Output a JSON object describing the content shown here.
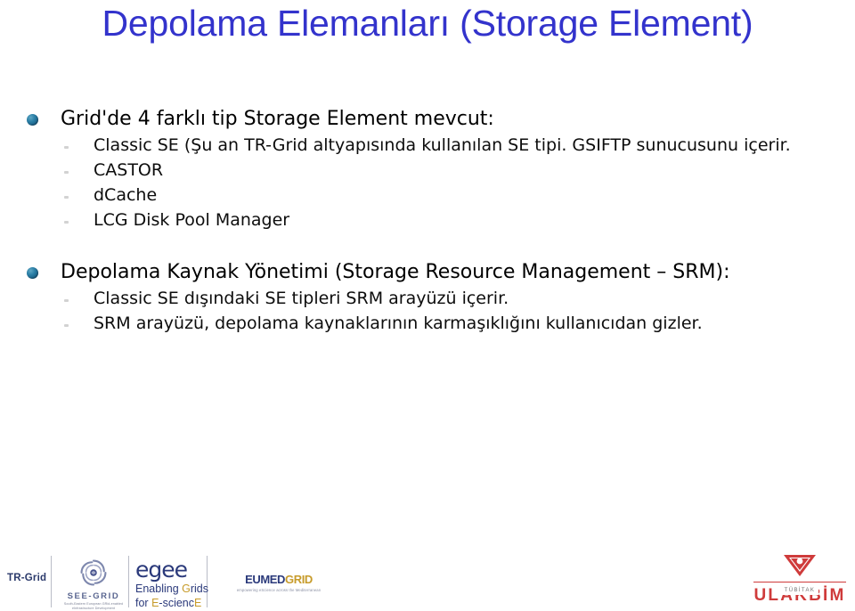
{
  "slide": {
    "title": "Depolama Elemanları (Storage Element)",
    "title_color": "#3333cc",
    "bullet_color": "#1f6b91"
  },
  "content": {
    "groups": [
      {
        "heading": "Grid'de 4 farklı tip Storage Element mevcut:",
        "items": [
          "Classic SE (Şu an TR-Grid altyapısında kullanılan SE tipi. GSIFTP sunucusunu içerir.",
          "CASTOR",
          "dCache",
          "LCG Disk Pool Manager"
        ]
      },
      {
        "heading": "Depolama Kaynak Yönetimi (Storage Resource Management – SRM):",
        "items": [
          "Classic SE dışındaki SE tipleri SRM arayüzü içerir.",
          "SRM arayüzü, depolama kaynaklarının karmaşıklığını kullanıcıdan gizler."
        ]
      }
    ]
  },
  "footer": {
    "trgrid_label": "TR-Grid",
    "seegrid": {
      "name": "SEE-GRID",
      "tagline_line1": "South-Eastern European GRid-enabled",
      "tagline_line2": "eInfrastructure Development"
    },
    "egee": {
      "wordmark": "egee",
      "sub_line1_a": "Enabling ",
      "sub_line1_b": "G",
      "sub_line1_c": "rids",
      "sub_line2_a": "for ",
      "sub_line2_b": "E",
      "sub_line2_c": "-scienc",
      "sub_line2_d": "E"
    },
    "eumedgrid": {
      "word_a": "EUMED",
      "word_b": "GRID",
      "tagline": "empowering eScience across the Mediterranean"
    },
    "ulakbim": {
      "tubitak": "TÜBİTAK",
      "name": "ULAKBİM"
    }
  }
}
